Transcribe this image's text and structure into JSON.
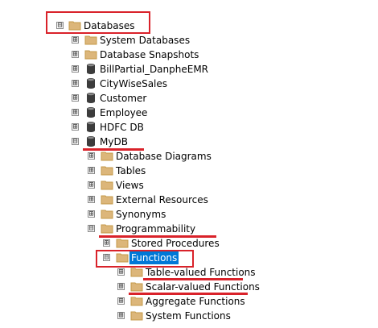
{
  "tree": {
    "root": {
      "label": "Databases",
      "expander": "⊟",
      "icon": "folder-icon"
    },
    "databases": [
      {
        "label": "System Databases",
        "expander": "⊞",
        "icon": "folder-icon"
      },
      {
        "label": "Database Snapshots",
        "expander": "⊞",
        "icon": "folder-icon"
      },
      {
        "label": "BillPartial_DanpheEMR",
        "expander": "⊞",
        "icon": "database-icon"
      },
      {
        "label": "CityWiseSales",
        "expander": "⊞",
        "icon": "database-icon"
      },
      {
        "label": "Customer",
        "expander": "⊞",
        "icon": "database-icon"
      },
      {
        "label": "Employee",
        "expander": "⊞",
        "icon": "database-icon"
      },
      {
        "label": "HDFC DB",
        "expander": "⊞",
        "icon": "database-icon"
      },
      {
        "label": "MyDB",
        "expander": "⊟",
        "icon": "database-icon"
      }
    ],
    "mydb_children": [
      {
        "label": "Database Diagrams",
        "expander": "⊞",
        "icon": "folder-icon"
      },
      {
        "label": "Tables",
        "expander": "⊞",
        "icon": "folder-icon"
      },
      {
        "label": "Views",
        "expander": "⊞",
        "icon": "folder-icon"
      },
      {
        "label": "External Resources",
        "expander": "⊞",
        "icon": "folder-icon"
      },
      {
        "label": "Synonyms",
        "expander": "⊞",
        "icon": "folder-icon"
      },
      {
        "label": "Programmability",
        "expander": "⊟",
        "icon": "folder-icon"
      }
    ],
    "programmability_children": [
      {
        "label": "Stored Procedures",
        "expander": "⊞",
        "icon": "folder-icon"
      },
      {
        "label": "Functions",
        "expander": "⊟",
        "icon": "folder-icon"
      }
    ],
    "functions_children": [
      {
        "label": "Table-valued Functions",
        "expander": "⊞",
        "icon": "folder-icon"
      },
      {
        "label": "Scalar-valued Functions",
        "expander": "⊞",
        "icon": "folder-icon"
      },
      {
        "label": "Aggregate Functions",
        "expander": "⊞",
        "icon": "folder-icon"
      },
      {
        "label": "System Functions",
        "expander": "⊞",
        "icon": "folder-icon"
      }
    ]
  },
  "colors": {
    "folder": "#dcb67a",
    "database": "#3c3c3c",
    "selection": "#0078d7",
    "annotation": "#d9222a"
  }
}
